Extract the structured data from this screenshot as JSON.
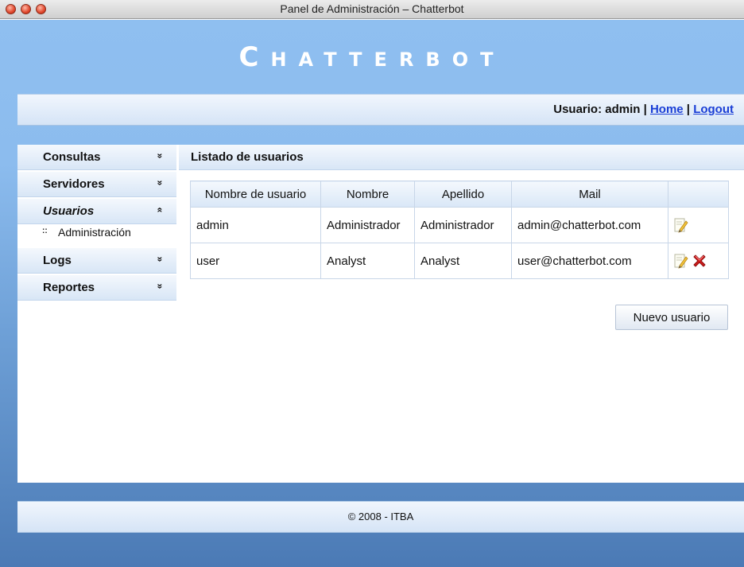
{
  "window": {
    "title": "Panel de Administración – Chatterbot"
  },
  "brand": {
    "first": "C",
    "rest": "HATTERBOT"
  },
  "userbar": {
    "prefix": "Usuario: admin | ",
    "home": "Home",
    "separator": " | ",
    "logout": "Logout"
  },
  "sidebar": {
    "items": [
      {
        "label": "Consultas",
        "chevron": "»"
      },
      {
        "label": "Servidores",
        "chevron": "»"
      },
      {
        "label": "Usuarios",
        "chevron": "«",
        "open": true,
        "subitems": [
          "Administración"
        ]
      },
      {
        "label": "Logs",
        "chevron": "»"
      },
      {
        "label": "Reportes",
        "chevron": "»"
      }
    ],
    "bullet": "::"
  },
  "main": {
    "heading": "Listado de usuarios",
    "table": {
      "headers": [
        "Nombre de usuario",
        "Nombre",
        "Apellido",
        "Mail",
        ""
      ],
      "rows": [
        {
          "username": "admin",
          "nombre": "Administrador",
          "apellido": "Administrador",
          "mail": "admin@chatterbot.com",
          "actions": [
            "edit-icon"
          ]
        },
        {
          "username": "user",
          "nombre": "Analyst",
          "apellido": "Analyst",
          "mail": "user@chatterbot.com",
          "actions": [
            "edit-icon",
            "delete-icon"
          ]
        }
      ]
    },
    "new_button": "Nuevo usuario"
  },
  "footer": {
    "text": "© 2008 - ITBA"
  },
  "colors": {
    "accent_link": "#1a3ed6",
    "frame_top": "#8fbff0",
    "frame_bottom": "#4b7ab5",
    "delete": "#d21c1c"
  }
}
